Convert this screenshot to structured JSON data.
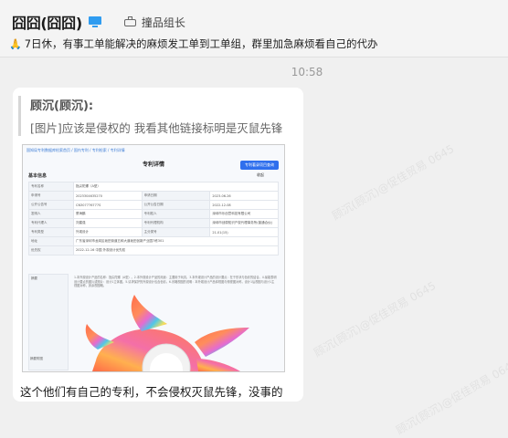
{
  "header": {
    "chat_name": "囧囧(囧囧)",
    "status_icon": "pc-online-icon",
    "group_tag": "撞品组长",
    "notice": "7日休，有事工单能解决的麻烦发工单到工单组，群里加急麻烦看自己的代办"
  },
  "timestamp": "10:58",
  "message": {
    "quote_author": "顾沉(顾沉):",
    "quote_text": "[图片]应该是侵权的 我看其他链接标明是灭鼠先锋",
    "caption": "这个他们有自己的专利，不会侵权灭鼠先锋，没事的"
  },
  "screenshot": {
    "breadcrumb": "国知局专利数据库检索首页 / 国内专利 / 专利检索 / 专利详情",
    "title": "专利详情",
    "button": "专利著录项目查询",
    "section": "基本信息",
    "action": "收起",
    "rows": [
      [
        "专利名称",
        "指尖陀螺（A型）",
        "",
        ""
      ],
      [
        "申请号",
        "2023304635270",
        "申请日期",
        "2023-06-26"
      ],
      [
        "公开公告号",
        "CN307776777S",
        "公开公告日期",
        "2022-12-08"
      ],
      [
        "发明人",
        "蔡海鹏",
        "专利权人",
        "深圳市乐创意科技有限公司"
      ],
      [
        "专利代理人",
        "刘建强",
        "专利代理机构",
        "深圳市创原知识产权代理事务所(普通合伙)"
      ],
      [
        "专利类型",
        "外观设计",
        "主分类号",
        "21-01(15)"
      ],
      [
        "地址",
        "广东省深圳市龙岗区坂田街道五和大道坂田创新产业园7栋301",
        "",
        ""
      ],
      [
        "优先权",
        "2022-12-16 中国 外观设计优先权",
        "",
        ""
      ]
    ],
    "summary_label": "摘要",
    "summary_text": "1.本外观设计产品的名称：指尖陀螺（A型）。2.本外观设计产品的用途：主要用于玩具，3.本外观设计产品的设计要点：在于形状与色彩的结合。4.最能表明设计要点的图片或照片：设计1立体图。5.请求保护的外观设计包含色彩。6.省略视图的说明：本外观设计产品仰视图与俯视图对称，设计1后视图与设计1主视图对称，其余视图略。",
    "image_label": "摘要附图"
  },
  "watermark": "顾沉(顾沉)@促佳贸易 0645",
  "colors": {
    "accent": "#2f9cf0",
    "link": "#3a7bd5",
    "button": "#2f6fed",
    "bubble": "#ffffff",
    "background": "#f0f0f0"
  }
}
